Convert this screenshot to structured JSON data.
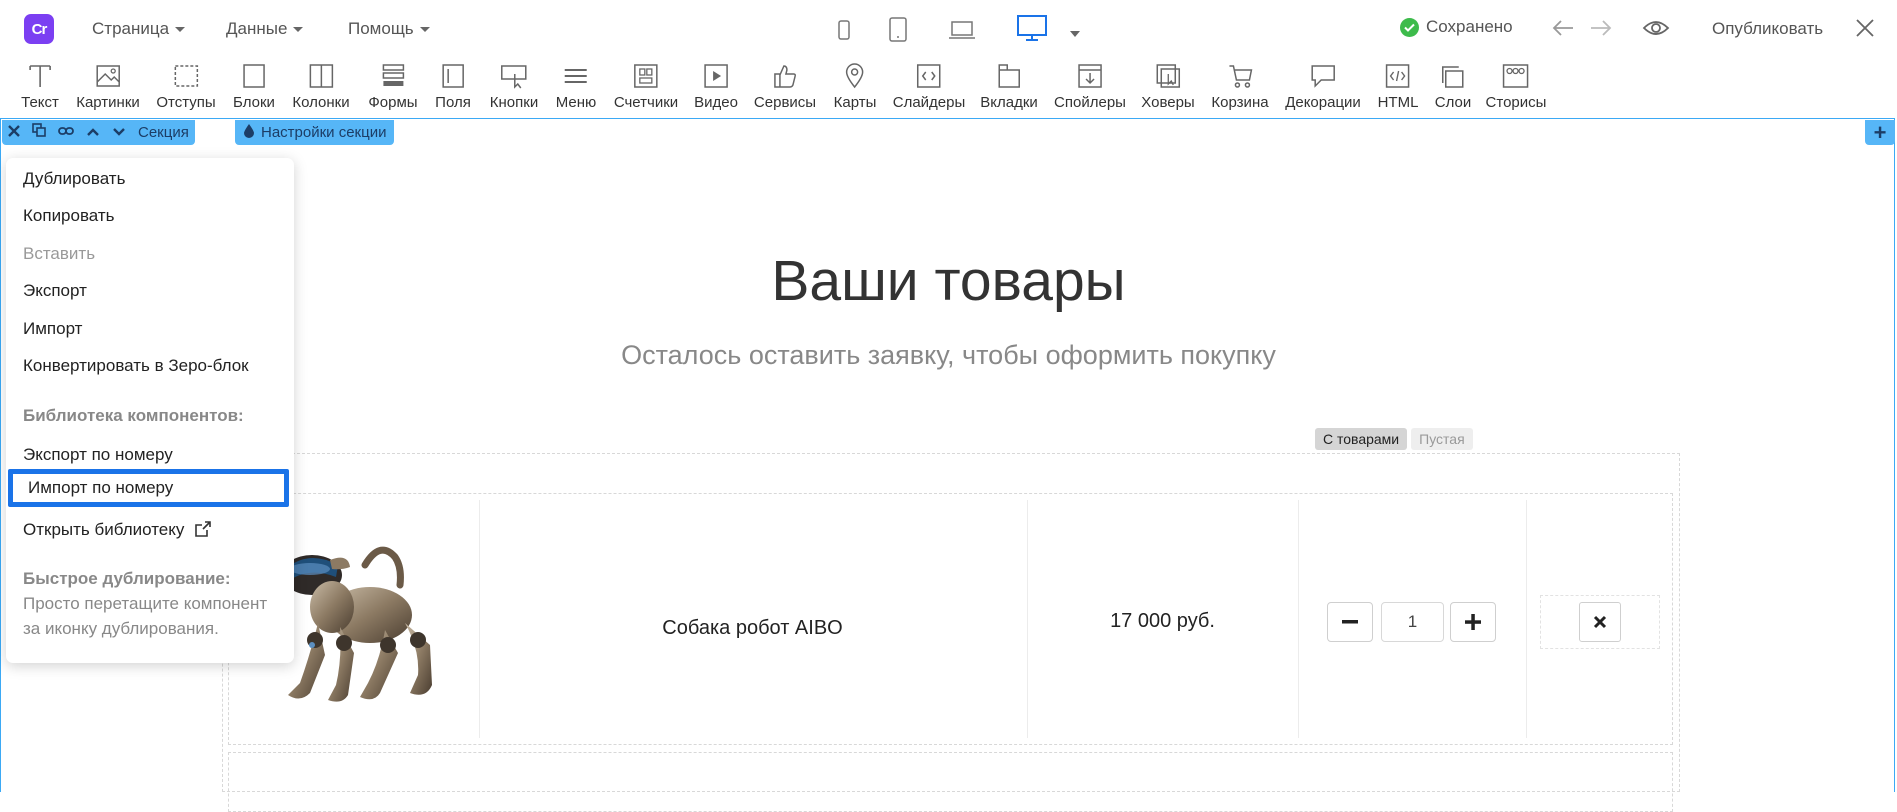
{
  "topbar": {
    "menu_page": "Страница",
    "menu_data": "Данные",
    "menu_help": "Помощь",
    "saved": "Сохранено",
    "publish": "Опубликовать",
    "logo_text": "Cr"
  },
  "toolbar": {
    "items": [
      {
        "label": "Текст",
        "icon": "text-icon"
      },
      {
        "label": "Картинки",
        "icon": "image-icon"
      },
      {
        "label": "Отступы",
        "icon": "padding-icon"
      },
      {
        "label": "Блоки",
        "icon": "block-icon"
      },
      {
        "label": "Колонки",
        "icon": "columns-icon"
      },
      {
        "label": "Формы",
        "icon": "forms-icon"
      },
      {
        "label": "Поля",
        "icon": "field-icon"
      },
      {
        "label": "Кнопки",
        "icon": "button-icon"
      },
      {
        "label": "Меню",
        "icon": "menu-icon"
      },
      {
        "label": "Счетчики",
        "icon": "counter-icon"
      },
      {
        "label": "Видео",
        "icon": "video-icon"
      },
      {
        "label": "Сервисы",
        "icon": "thumbs-up-icon"
      },
      {
        "label": "Карты",
        "icon": "map-pin-icon"
      },
      {
        "label": "Слайдеры",
        "icon": "slider-icon"
      },
      {
        "label": "Вкладки",
        "icon": "tabs-icon"
      },
      {
        "label": "Спойлеры",
        "icon": "spoiler-icon"
      },
      {
        "label": "Ховеры",
        "icon": "hover-icon"
      },
      {
        "label": "Корзина",
        "icon": "cart-icon"
      },
      {
        "label": "Декорации",
        "icon": "decoration-icon"
      },
      {
        "label": "HTML",
        "icon": "html-icon"
      },
      {
        "label": "Слои",
        "icon": "layers-icon"
      },
      {
        "label": "Сторисы",
        "icon": "stories-icon"
      }
    ]
  },
  "section": {
    "label": "Секция",
    "settings_label": "Настройки секции"
  },
  "context_menu": {
    "duplicate": "Дублировать",
    "copy": "Копировать",
    "paste": "Вставить",
    "export": "Экспорт",
    "import": "Импорт",
    "convert": "Конвертировать в Зеро-блок",
    "library_header": "Библиотека компонентов:",
    "export_by_number": "Экспорт по номеру",
    "import_by_number": "Импорт по номеру",
    "open_library": "Открыть библиотеку",
    "quick_dup_header": "Быстрое дублирование:",
    "quick_dup_line1": "Просто перетащите компонент",
    "quick_dup_line2": "за иконку дублирования."
  },
  "content": {
    "heading": "Ваши товары",
    "subheading": "Осталось оставить заявку, чтобы оформить покупку",
    "tab_with_items": "С товарами",
    "tab_empty": "Пустая",
    "product_name": "Собака робот AIBO",
    "product_price": "17 000 руб.",
    "quantity": "1",
    "minus": "−",
    "plus": "+"
  }
}
